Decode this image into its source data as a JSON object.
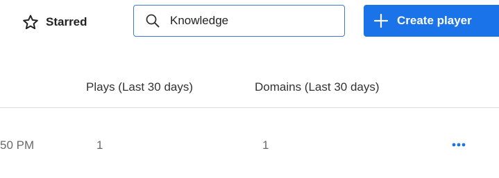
{
  "toolbar": {
    "starred_label": "Starred",
    "search_value": "Knowledge",
    "create_label": "Create player"
  },
  "table": {
    "headers": [
      "Plays (Last 30 days)",
      "Domains (Last 30 days)"
    ],
    "rows": [
      {
        "time": "50 PM",
        "plays": "1",
        "domains": "1"
      }
    ]
  },
  "icons": {
    "starred": "star-outline-icon",
    "search": "search-icon",
    "create": "plus-icon",
    "more": "more-horizontal-icon"
  },
  "colors": {
    "accent": "#1a73e8",
    "search_border": "#3a7bd5"
  }
}
